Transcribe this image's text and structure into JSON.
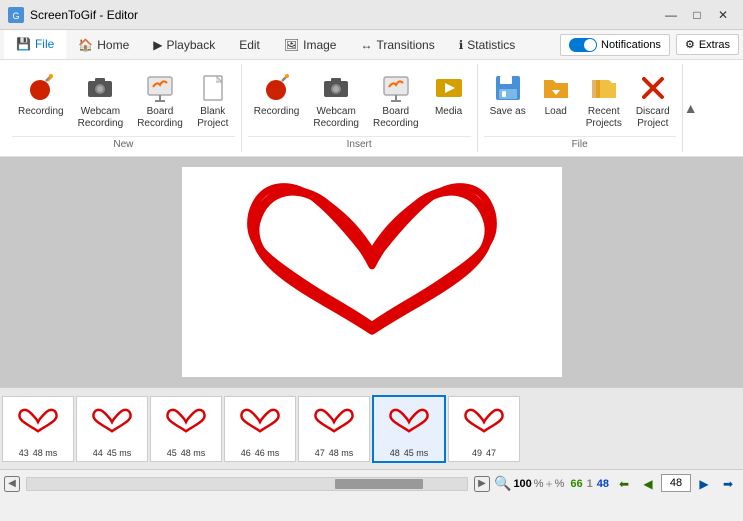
{
  "window": {
    "title": "ScreenToGif - Editor",
    "icon": "🎬"
  },
  "menu": {
    "tabs": [
      {
        "id": "file",
        "label": "File",
        "active": true,
        "icon": "💾"
      },
      {
        "id": "home",
        "label": "Home",
        "active": false,
        "icon": "🏠"
      },
      {
        "id": "playback",
        "label": "Playback",
        "active": false,
        "icon": "▶"
      },
      {
        "id": "edit",
        "label": "Edit",
        "active": false,
        "icon": ""
      },
      {
        "id": "image",
        "label": "Image",
        "active": false,
        "icon": "🖼"
      },
      {
        "id": "transitions",
        "label": "Transitions",
        "active": false,
        "icon": "↔"
      },
      {
        "id": "statistics",
        "label": "Statistics",
        "active": false,
        "icon": "ℹ"
      },
      {
        "id": "notifications",
        "label": "Notifications",
        "active": false,
        "icon": "🔔"
      },
      {
        "id": "extras",
        "label": "Extras",
        "active": false,
        "icon": "⚙"
      }
    ]
  },
  "ribbon": {
    "groups": [
      {
        "id": "new",
        "label": "New",
        "buttons": [
          {
            "id": "recording",
            "label": "Recording",
            "icon": "bomb"
          },
          {
            "id": "webcam-recording",
            "label": "Webcam\nRecording",
            "icon": "camera"
          },
          {
            "id": "board-recording",
            "label": "Board\nRecording",
            "icon": "board"
          },
          {
            "id": "blank-project",
            "label": "Blank\nProject",
            "icon": "blank"
          }
        ]
      },
      {
        "id": "insert",
        "label": "Insert",
        "buttons": [
          {
            "id": "recording2",
            "label": "Recording",
            "icon": "bomb2"
          },
          {
            "id": "webcam-recording2",
            "label": "Webcam\nRecording",
            "icon": "camera2"
          },
          {
            "id": "board-recording2",
            "label": "Board\nRecording",
            "icon": "board2"
          },
          {
            "id": "media",
            "label": "Media",
            "icon": "media"
          }
        ]
      },
      {
        "id": "file",
        "label": "File",
        "buttons": [
          {
            "id": "save-as",
            "label": "Save as",
            "icon": "saveas"
          },
          {
            "id": "load",
            "label": "Load",
            "icon": "load"
          },
          {
            "id": "recent-projects",
            "label": "Recent\nProjects",
            "icon": "recent"
          },
          {
            "id": "discard-project",
            "label": "Discard\nProject",
            "icon": "discard"
          }
        ]
      }
    ]
  },
  "filmstrip": {
    "frames": [
      {
        "num": 43,
        "time": "48 ms"
      },
      {
        "num": 44,
        "time": "45 ms"
      },
      {
        "num": 45,
        "time": "48 ms"
      },
      {
        "num": 46,
        "time": "46 ms"
      },
      {
        "num": 47,
        "time": "48 ms"
      },
      {
        "num": 48,
        "time": "45 ms",
        "selected": true
      },
      {
        "num": 49,
        "time": "47"
      }
    ]
  },
  "statusbar": {
    "zoom": "100",
    "zoom_pct": "%",
    "coord_x": "66",
    "coord_y": "1",
    "coord_z": "48"
  },
  "colors": {
    "accent": "#0078d4",
    "selected_border": "#0078d4",
    "heart": "#dd0000",
    "nav_prev": "#2a7000",
    "nav_next": "#0050a0"
  }
}
